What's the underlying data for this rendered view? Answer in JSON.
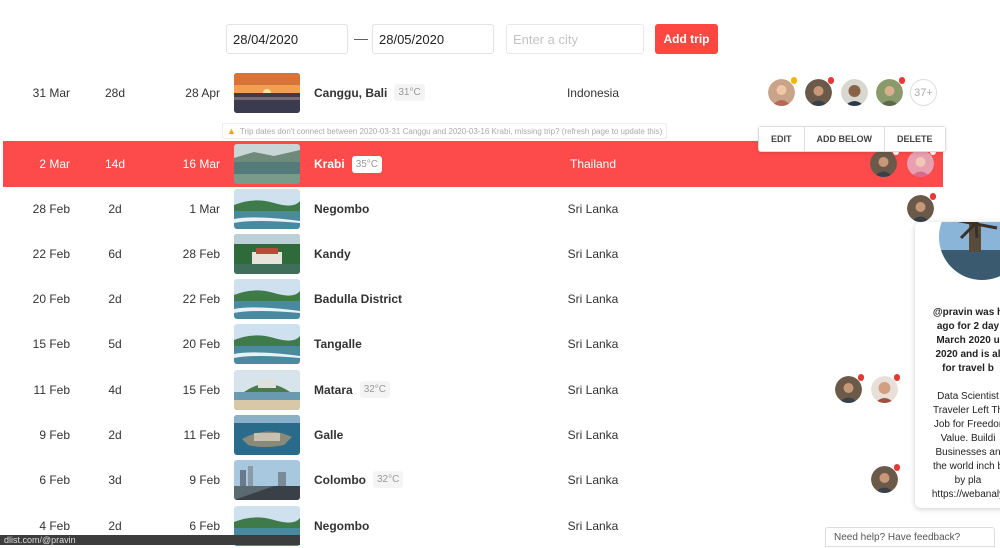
{
  "filter": {
    "start_date": "28/04/2020",
    "separator": "—",
    "end_date": "28/05/2020",
    "city_placeholder": "Enter a city",
    "add_button": "Add trip"
  },
  "trips": [
    {
      "start": "31 Mar",
      "duration": "28d",
      "end": "28 Apr",
      "city": "Canggu, Bali",
      "temp": "31°C",
      "country": "Indonesia"
    },
    {
      "start": "2 Mar",
      "duration": "14d",
      "end": "16 Mar",
      "city": "Krabi",
      "temp": "35°C",
      "country": "Thailand"
    },
    {
      "start": "28 Feb",
      "duration": "2d",
      "end": "1 Mar",
      "city": "Negombo",
      "temp": "",
      "country": "Sri Lanka"
    },
    {
      "start": "22 Feb",
      "duration": "6d",
      "end": "28 Feb",
      "city": "Kandy",
      "temp": "",
      "country": "Sri Lanka"
    },
    {
      "start": "20 Feb",
      "duration": "2d",
      "end": "22 Feb",
      "city": "Badulla District",
      "temp": "",
      "country": "Sri Lanka"
    },
    {
      "start": "15 Feb",
      "duration": "5d",
      "end": "20 Feb",
      "city": "Tangalle",
      "temp": "",
      "country": "Sri Lanka"
    },
    {
      "start": "11 Feb",
      "duration": "4d",
      "end": "15 Feb",
      "city": "Matara",
      "temp": "32°C",
      "country": "Sri Lanka"
    },
    {
      "start": "9 Feb",
      "duration": "2d",
      "end": "11 Feb",
      "city": "Galle",
      "temp": "",
      "country": "Sri Lanka"
    },
    {
      "start": "6 Feb",
      "duration": "3d",
      "end": "9 Feb",
      "city": "Colombo",
      "temp": "32°C",
      "country": "Sri Lanka"
    },
    {
      "start": "4 Feb",
      "duration": "2d",
      "end": "6 Feb",
      "city": "Negombo",
      "temp": "",
      "country": "Sri Lanka"
    }
  ],
  "more_count": "37+",
  "warning": "Trip dates don't connect between 2020-03-31 Canggu and 2020-03-16 Krabi, missing trip? (refresh page to update this)",
  "row_actions": {
    "edit": "EDIT",
    "add_below": "ADD BELOW",
    "delete": "DELETE"
  },
  "profile": {
    "title_lines": [
      "@pravin was h",
      "ago for 2 day",
      "March 2020 u",
      "2020 and is al",
      "for travel b"
    ],
    "bio_lines": [
      "Data Scientist",
      "Traveler Left Th",
      "Job for Freedor",
      "Value. Buildi",
      "Businesses an",
      "the world inch b",
      "by pla",
      "https://webanaly"
    ]
  },
  "status_url": "dlist.com/@pravin",
  "help": "Need help? Have feedback?",
  "colors": {
    "accent": "#fd4a4a",
    "button": "#ff4742"
  }
}
